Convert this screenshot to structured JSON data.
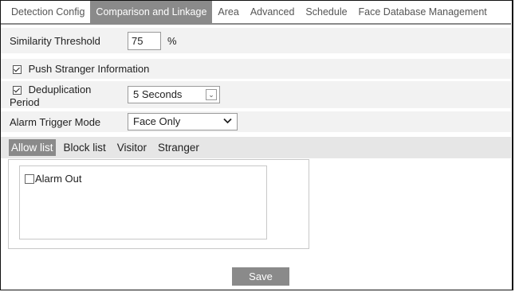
{
  "tabs": [
    {
      "label": "Detection Config"
    },
    {
      "label": "Comparison and Linkage"
    },
    {
      "label": "Area"
    },
    {
      "label": "Advanced"
    },
    {
      "label": "Schedule"
    },
    {
      "label": "Face Database Management"
    }
  ],
  "active_tab": "Comparison and Linkage",
  "similarity": {
    "label": "Similarity Threshold",
    "value": "75",
    "unit": "%"
  },
  "push_stranger": {
    "label": "Push Stranger Information",
    "checked": true
  },
  "deduplication": {
    "label_line1": "Deduplication",
    "label_line2": "Period",
    "checked": true,
    "value": "5 Seconds"
  },
  "alarm_trigger": {
    "label": "Alarm Trigger Mode",
    "value": "Face Only"
  },
  "subtabs": [
    {
      "label": "Allow list"
    },
    {
      "label": "Block list"
    },
    {
      "label": "Visitor"
    },
    {
      "label": "Stranger"
    }
  ],
  "active_subtab": "Allow list",
  "alarm_out": {
    "label": "Alarm Out",
    "checked": false
  },
  "save_label": "Save",
  "colors": {
    "accent_gray": "#8a8a8a",
    "panel_bg": "#f2f2f2"
  }
}
